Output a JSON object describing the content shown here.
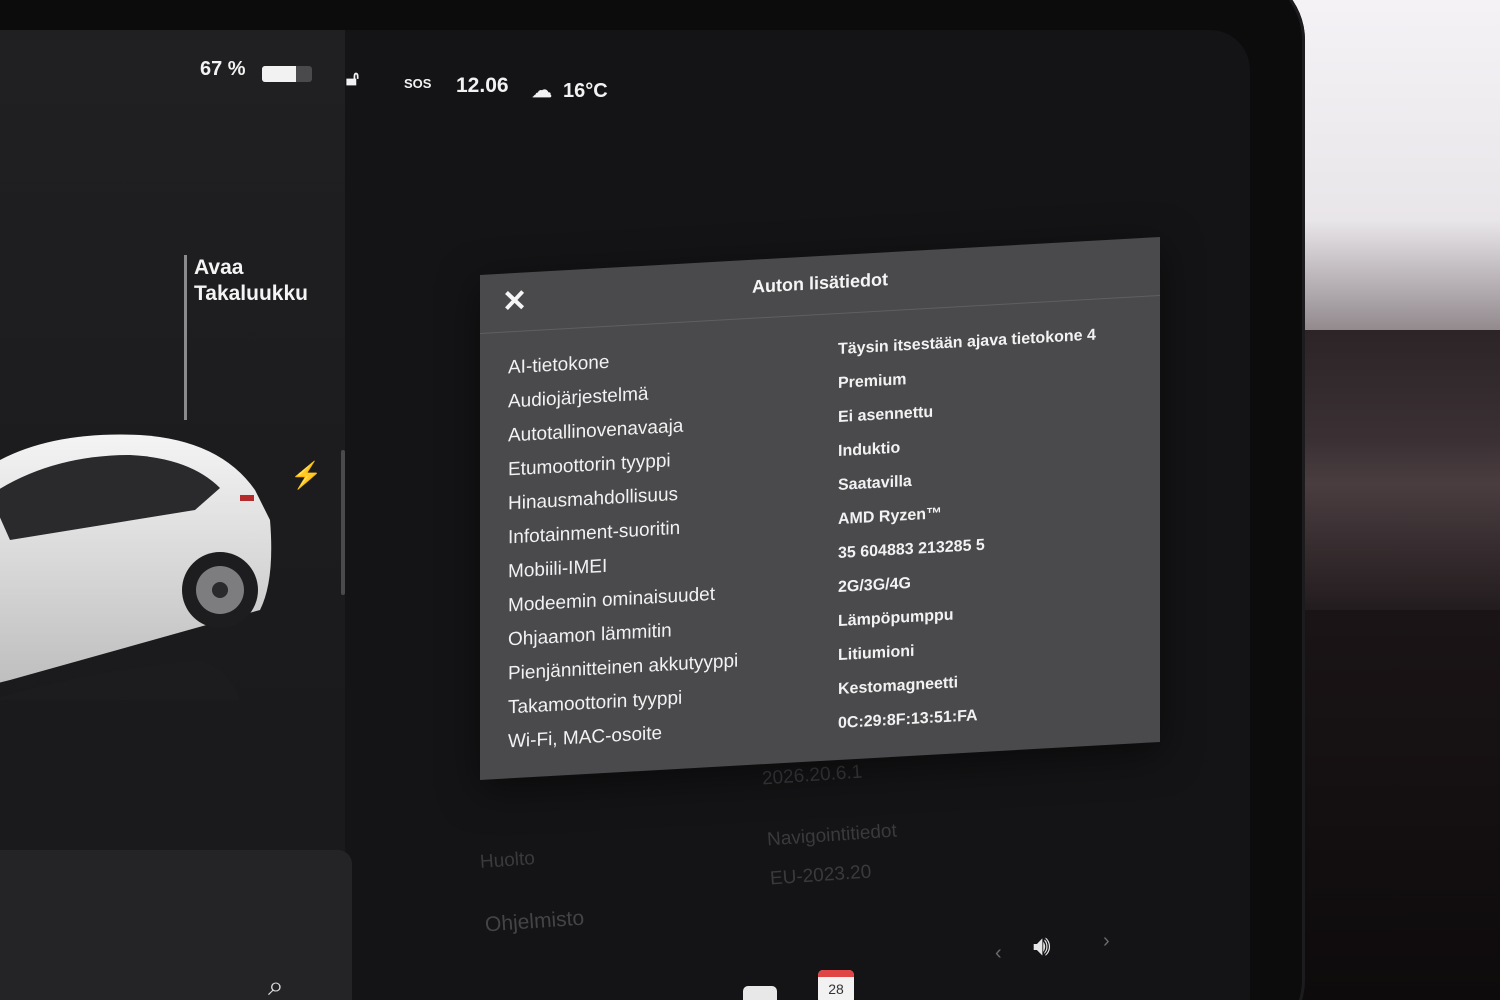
{
  "status_bar": {
    "battery_percent_label": "67 %",
    "battery_level": 0.67,
    "sos_label": "SOS",
    "time": "12.06",
    "temperature": "16°C"
  },
  "car_panel": {
    "trunk_button_line1": "Avaa",
    "trunk_button_line2": "Takaluukku"
  },
  "modal": {
    "title": "Auton lisätiedot",
    "rows": [
      {
        "label": "AI-tietokone",
        "value": "Täysin itsestään ajava tietokone 4"
      },
      {
        "label": "Audiojärjestelmä",
        "value": "Premium"
      },
      {
        "label": "Autotallinovenavaaja",
        "value": "Ei asennettu"
      },
      {
        "label": "Etumoottorin tyyppi",
        "value": "Induktio"
      },
      {
        "label": "Hinausmahdollisuus",
        "value": "Saatavilla"
      },
      {
        "label": "Infotainment-suoritin",
        "value": "AMD Ryzen™"
      },
      {
        "label": "Mobiili-IMEI",
        "value": "35 604883 213285 5"
      },
      {
        "label": "Modeemin ominaisuudet",
        "value": "2G/3G/4G"
      },
      {
        "label": "Ohjaamon lämmitin",
        "value": "Lämpöpumppu"
      },
      {
        "label": "Pienjännitteinen akkutyyppi",
        "value": "Litiumioni"
      },
      {
        "label": "Takamoottorin tyyppi",
        "value": "Kestomagneetti"
      },
      {
        "label": "Wi-Fi, MAC-osoite",
        "value": "0C:29:8F:13:51:FA"
      }
    ]
  },
  "background_settings": {
    "version_value": "2026.20.6.1",
    "navigation_label": "Navigointitiedot",
    "navigation_value": "EU-2023.20",
    "software_label": "Ohjelmisto",
    "service_label": "Huolto"
  },
  "bottom_bar": {
    "calendar_day": "28"
  },
  "colors": {
    "modal_bg": "#4a4a4d",
    "screen_bg": "#141416",
    "text": "#f2f2f2"
  }
}
